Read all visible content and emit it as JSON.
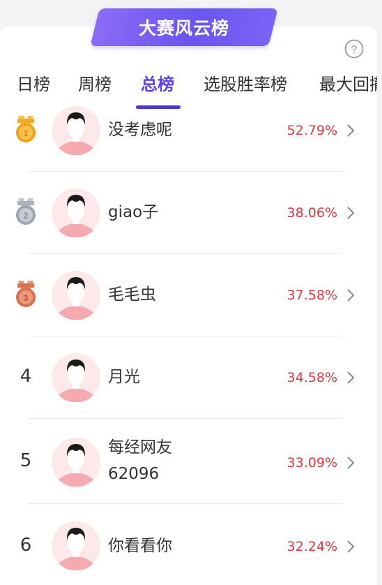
{
  "header": {
    "title": "大赛风云榜"
  },
  "tabs": [
    {
      "label": "日榜"
    },
    {
      "label": "周榜"
    },
    {
      "label": "总榜"
    },
    {
      "label": "选股胜率榜"
    },
    {
      "label": "最大回撤"
    }
  ],
  "active_tab": "总榜",
  "rows": [
    {
      "rank": "1",
      "medal": "gold-medal-icon",
      "name_line1": "没考虑呢",
      "name_line2": "",
      "rate": "52.79%"
    },
    {
      "rank": "2",
      "medal": "silver-medal-icon",
      "name_line1": "giao子",
      "name_line2": "",
      "rate": "38.06%"
    },
    {
      "rank": "3",
      "medal": "bronze-medal-icon",
      "name_line1": "毛毛虫",
      "name_line2": "",
      "rate": "37.58%"
    },
    {
      "rank": "4",
      "medal": "",
      "name_line1": "月光",
      "name_line2": "",
      "rate": "34.58%"
    },
    {
      "rank": "5",
      "medal": "",
      "name_line1": "每经网友",
      "name_line2": "62096",
      "rate": "33.09%"
    },
    {
      "rank": "6",
      "medal": "",
      "name_line1": "你看看你",
      "name_line2": "",
      "rate": "32.24%"
    }
  ],
  "colors": {
    "accent": "#5a45e6",
    "rate": "#e0383f",
    "gold": "#f0a21f",
    "silver": "#9ea6b0",
    "bronze": "#d9714d"
  }
}
